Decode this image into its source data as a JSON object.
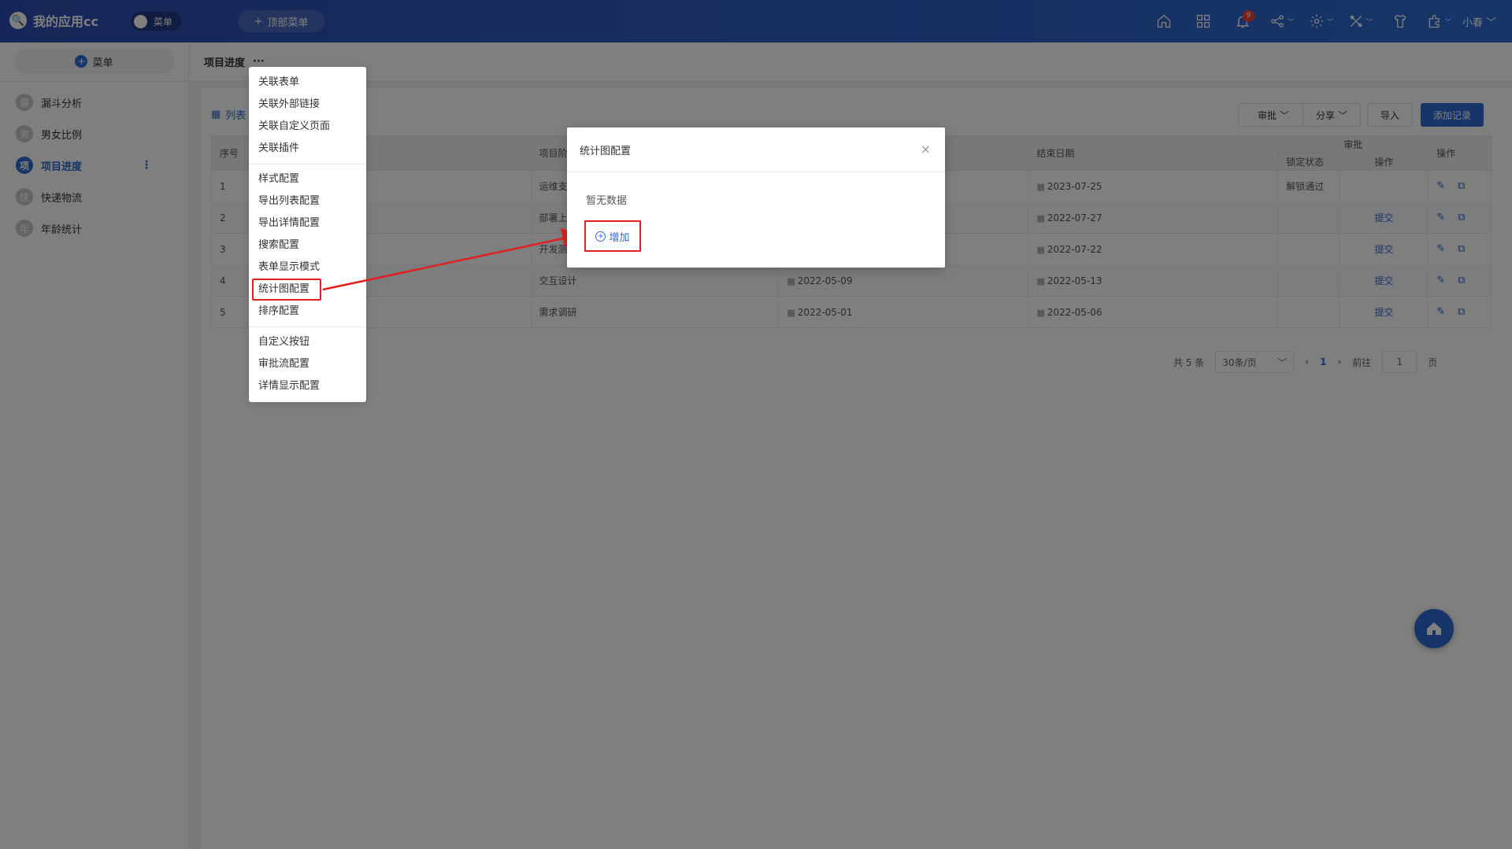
{
  "app": {
    "title": "我的应用cc",
    "menu_toggle": "菜单",
    "top_menu_button": "顶部菜单",
    "user": "小春",
    "notification_count": "9"
  },
  "sidebar": {
    "add_button": "菜单",
    "items": [
      {
        "avatar": "漏",
        "label": "漏斗分析"
      },
      {
        "avatar": "男",
        "label": "男女比例"
      },
      {
        "avatar": "项",
        "label": "项目进度"
      },
      {
        "avatar": "快",
        "label": "快递物流"
      },
      {
        "avatar": "年",
        "label": "年龄统计"
      }
    ],
    "more_icon": "⋮"
  },
  "breadcrumb": {
    "title": "项目进度",
    "more": "···"
  },
  "toolbar": {
    "list_tab": "列表",
    "approve": "审批",
    "share": "分享",
    "import": "导入",
    "add_record": "添加记录"
  },
  "table": {
    "headers": {
      "seq": "序号",
      "stage": "项目阶段",
      "end_date": "结束日期",
      "approval_group": "审批",
      "lock_status": "锁定状态",
      "approval_op": "操作",
      "ops": "操作"
    },
    "rows": [
      {
        "seq": "1",
        "stage": "运维支持",
        "start": "",
        "end": "2023-07-25",
        "lock": "解锁通过",
        "approve": ""
      },
      {
        "seq": "2",
        "stage": "部署上线",
        "start": "",
        "end": "2022-07-27",
        "lock": "",
        "approve": "提交"
      },
      {
        "seq": "3",
        "stage": "开发测试",
        "start": "",
        "end": "2022-07-22",
        "lock": "",
        "approve": "提交"
      },
      {
        "seq": "4",
        "stage": "交互设计",
        "start": "2022-05-09",
        "end": "2022-05-13",
        "lock": "",
        "approve": "提交"
      },
      {
        "seq": "5",
        "stage": "需求调研",
        "start": "2022-05-01",
        "end": "2022-05-06",
        "lock": "",
        "approve": "提交"
      }
    ]
  },
  "pager": {
    "total": "共 5 条",
    "page_size": "30条/页",
    "current": "1",
    "goto": "前往",
    "goto_value": "1",
    "page_unit": "页"
  },
  "dropdown": {
    "group1": [
      "关联表单",
      "关联外部链接",
      "关联自定义页面",
      "关联插件"
    ],
    "group2": [
      "样式配置",
      "导出列表配置",
      "导出详情配置",
      "搜索配置",
      "表单显示模式",
      "统计图配置",
      "排序配置"
    ],
    "group3": [
      "自定义按钮",
      "审批流配置",
      "详情显示配置"
    ]
  },
  "modal": {
    "title": "统计图配置",
    "empty": "暂无数据",
    "add_button": "增加",
    "close": "×"
  },
  "colors": {
    "primary": "#2f6bd1",
    "highlight": "#e02020"
  }
}
